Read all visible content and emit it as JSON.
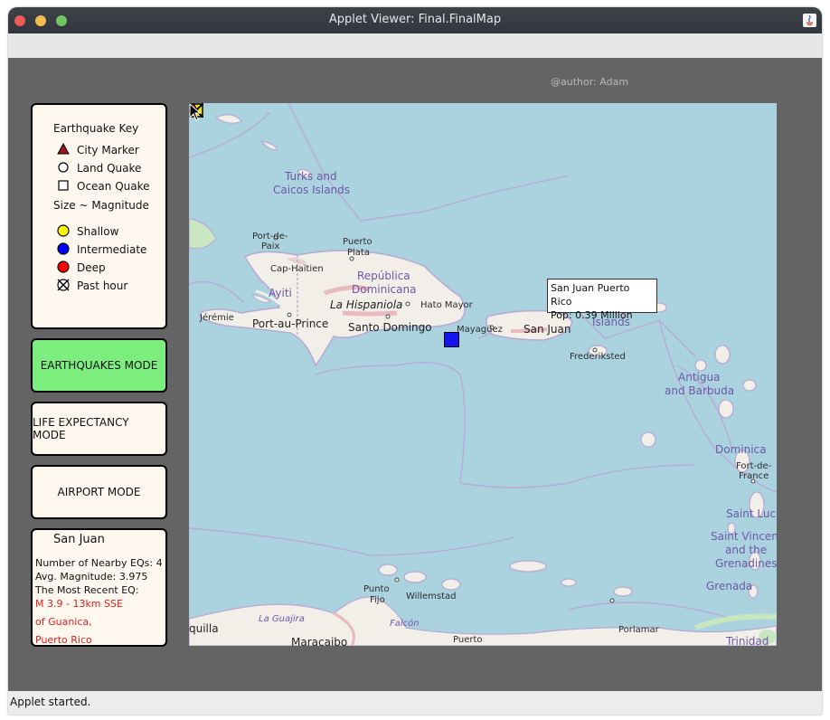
{
  "window": {
    "title": "Applet Viewer: Final.FinalMap"
  },
  "applet": {
    "author": "@author: Adam",
    "status": "Applet started."
  },
  "key": {
    "title": "Earthquake Key",
    "items": [
      {
        "label": "City Marker",
        "icon": "city-marker-icon"
      },
      {
        "label": "Land Quake",
        "icon": "land-quake-icon"
      },
      {
        "label": "Ocean Quake",
        "icon": "ocean-quake-icon"
      }
    ],
    "size_label": "Size ~ Magnitude",
    "depth_items": [
      {
        "label": "Shallow",
        "color": "#ffff00"
      },
      {
        "label": "Intermediate",
        "color": "#0000ff"
      },
      {
        "label": "Deep",
        "color": "#ff0000"
      },
      {
        "label": "Past hour",
        "icon": "past-hour-icon"
      }
    ]
  },
  "modes": {
    "earthquakes": "EARTHQUAKES MODE",
    "life_expectancy": "LIFE EXPECTANCY MODE",
    "airport": "AIRPORT MODE",
    "active_color": "#7cee7e"
  },
  "info": {
    "city": "San Juan",
    "nearby": "Number of Nearby EQs: 4",
    "avg": "Avg. Magnitude:  3.975",
    "recent_label": "The Most Recent EQ:",
    "recent_line1": "M 3.9 - 13km SSE",
    "recent_line2": "of Guanica,",
    "recent_line3": "Puerto Rico"
  },
  "map": {
    "labels": {
      "turks1": "Turks and",
      "turks2": "Caicos Islands",
      "portdepaix1": "Port-de-",
      "portdepaix2": "Paix",
      "puertoplata1": "Puerto",
      "puertoplata2": "Plata",
      "caphaitien": "Cap-Haïtien",
      "republica": "República",
      "dominicana": "Dominicana",
      "ayiti": "Ayiti",
      "lahispaniola": "La Hispaniola",
      "hatomayor": "Hato Mayor",
      "jeremie": "Jérémie",
      "portauprince": "Port-au-Prince",
      "santodomingo": "Santo Domingo",
      "mayaguez": "Mayagüez",
      "sanjuan": "San Juan",
      "islands": "Islands",
      "frederiksted": "Frederiksted",
      "antigua1": "Antigua",
      "antigua2": "and Barbuda",
      "dominica": "Dominica",
      "fortdefrance1": "Fort-de-",
      "fortdefrance2": "France",
      "saintluc": "Saint Luc",
      "saintvincent1": "Saint Vincen",
      "saintvincent2": "and the",
      "saintvincent3": "Grenadines",
      "grenada": "Grenada",
      "puntofijo1": "Punto",
      "puntofijo2": "Fijo",
      "willemstad": "Willemstad",
      "laguajira": "La Guajira",
      "falcon": "Falcón",
      "quilla": "quilla",
      "maracaibo": "Maracaibo",
      "puerto": "Puerto",
      "porlamar": "Porlamar",
      "trinidad": "Trinidad"
    },
    "tooltip_line1": "San Juan Puerto Rico",
    "tooltip_line2": "Pop: 0.39 Million"
  }
}
